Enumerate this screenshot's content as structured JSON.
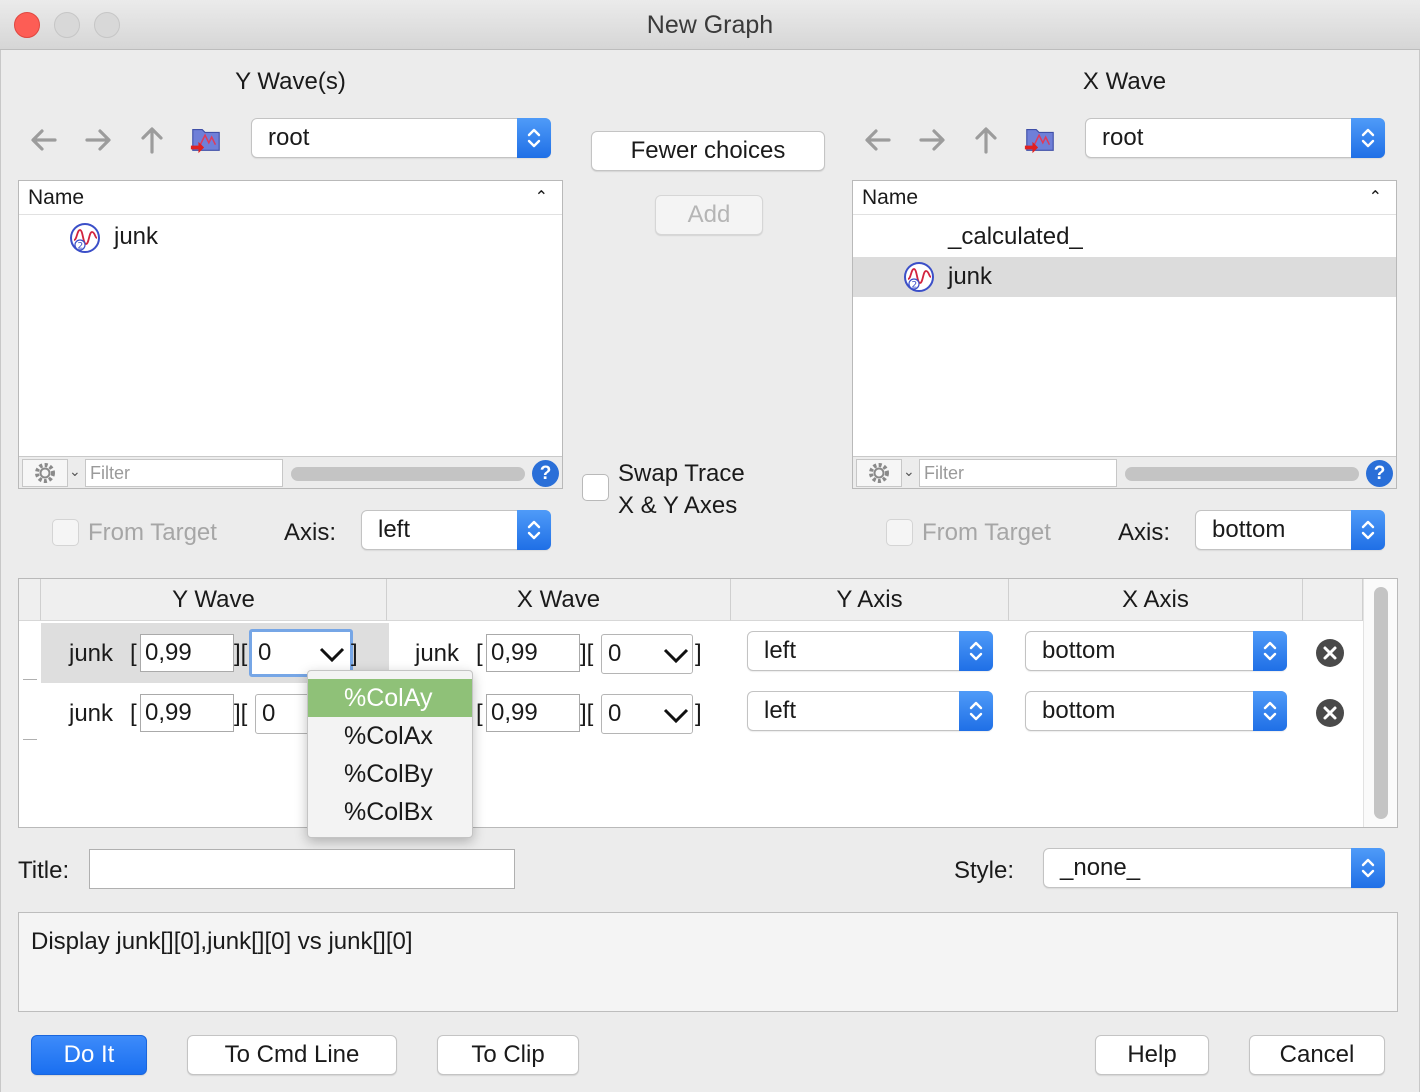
{
  "window": {
    "title": "New Graph"
  },
  "y_panel": {
    "heading": "Y Wave(s)",
    "folder": "root",
    "list_header": "Name",
    "items": [
      "junk"
    ],
    "filter_placeholder": "Filter",
    "help": "?",
    "from_target": "From Target",
    "axis_label": "Axis:",
    "axis_value": "left"
  },
  "x_panel": {
    "heading": "X Wave",
    "folder": "root",
    "list_header": "Name",
    "items": [
      "_calculated_",
      "junk"
    ],
    "filter_placeholder": "Filter",
    "help": "?",
    "from_target": "From Target",
    "axis_label": "Axis:",
    "axis_value": "bottom"
  },
  "middle": {
    "fewer_choices": "Fewer choices",
    "add": "Add",
    "swap_line1": "Swap Trace",
    "swap_line2": "X & Y Axes"
  },
  "table": {
    "columns": [
      "Y Wave",
      "X Wave",
      "Y Axis",
      "X Axis"
    ],
    "rows": [
      {
        "y_name": "junk",
        "y_range": "0,99",
        "y_col": "0",
        "x_name": "junk",
        "x_range": "0,99",
        "x_col": "0",
        "y_axis": "left",
        "x_axis": "bottom"
      },
      {
        "y_name": "junk",
        "y_range": "0,99",
        "y_col": "0",
        "x_name": "junk",
        "x_range": "0,99",
        "x_col": "0",
        "y_axis": "left",
        "x_axis": "bottom"
      }
    ],
    "bracket_open": "[",
    "bracket_mid": "][",
    "bracket_close": "]"
  },
  "column_menu": {
    "items": [
      "%ColAy",
      "%ColAx",
      "%ColBy",
      "%ColBx"
    ],
    "highlighted": "%ColAy"
  },
  "title_field": {
    "label": "Title:",
    "value": ""
  },
  "style_field": {
    "label": "Style:",
    "value": "_none_"
  },
  "command": "Display junk[][0],junk[][0] vs junk[][0]",
  "buttons": {
    "do_it": "Do It",
    "to_cmd": "To Cmd Line",
    "to_clip": "To Clip",
    "help": "Help",
    "cancel": "Cancel"
  },
  "colors": {
    "accent": "#1f6fe6",
    "menu_highlight": "#8fc178"
  }
}
